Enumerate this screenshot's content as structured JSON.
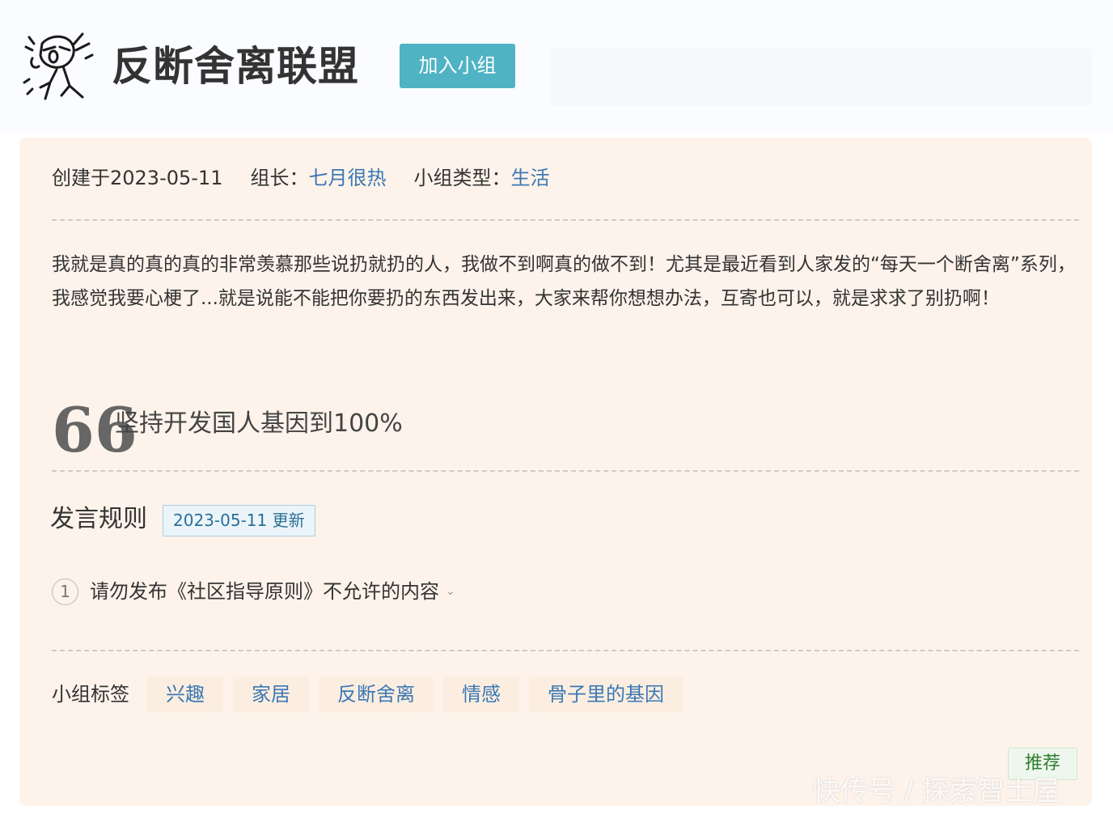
{
  "header": {
    "group_name": "反断舍离联盟",
    "join_label": "加入小组"
  },
  "info": {
    "created_label": "创建于2023-05-11",
    "owner_label": "组长：",
    "owner_name": "七月很热",
    "type_label": "小组类型：",
    "type_value": "生活"
  },
  "description": "我就是真的真的真的非常羡慕那些说扔就扔的人，我做不到啊真的做不到！尤其是最近看到人家发的“每天一个断舍离”系列，我感觉我要心梗了...就是说能不能把你要扔的东西发出来，大家来帮你想想办法，互寄也可以，就是求求了别扔啊！",
  "quote": {
    "mark": "66",
    "text": "坚持开发国人基因到100%"
  },
  "rules": {
    "title": "发言规则",
    "updated_badge": "2023-05-11 更新",
    "items": [
      {
        "number": "1",
        "text": "请勿发布《社区指导原则》不允许的内容",
        "chevron": "⌄"
      }
    ]
  },
  "tags": {
    "label": "小组标签",
    "items": [
      "兴趣",
      "家居",
      "反断舍离",
      "情感",
      "骨子里的基因"
    ]
  },
  "recommend_label": "推荐",
  "watermark": "快传号 / 探索智士屋",
  "colors": {
    "join_button": "#4fb3c4",
    "link": "#3c78b4",
    "card_background": "#fdf3ea",
    "recommend_text": "#2f7d32"
  },
  "icons": {
    "group_avatar": "stressed-cartoon-figure-icon"
  }
}
